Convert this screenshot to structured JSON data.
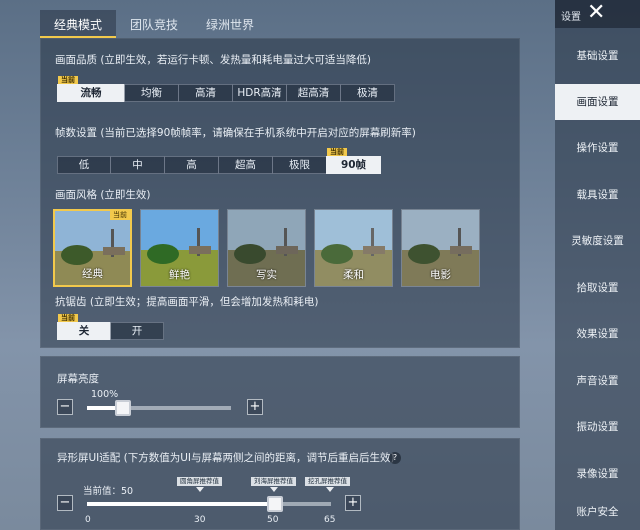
{
  "top_tabs": [
    "经典模式",
    "团队竞技",
    "绿洲世界"
  ],
  "quality": {
    "label": "画面品质 (立即生效，若运行卡顿、发热量和耗电量过大可适当降低)",
    "options": [
      "流畅",
      "均衡",
      "高清",
      "HDR高清",
      "超高清",
      "极清"
    ],
    "current_badge": "当前"
  },
  "fps": {
    "label": "帧数设置 (当前已选择90帧帧率，请确保在手机系统中开启对应的屏幕刷新率)",
    "options": [
      "低",
      "中",
      "高",
      "超高",
      "极限",
      "90帧"
    ],
    "current_badge": "当前"
  },
  "style": {
    "label": "画面风格 (立即生效)",
    "options": [
      "经典",
      "鲜艳",
      "写实",
      "柔和",
      "电影"
    ],
    "current_badge": "当前"
  },
  "aa": {
    "label": "抗锯齿 (立即生效；提高画面平滑，但会增加发热和耗电)",
    "options": [
      "关",
      "开"
    ],
    "current_badge": "当前"
  },
  "brightness": {
    "label": "屏幕亮度",
    "value_text": "100%",
    "value": 0.25,
    "minus": "−",
    "plus": "+"
  },
  "notch": {
    "label": "异形屏UI适配 (下方数值为UI与屏幕两侧之间的距离，调节后重启后生效)",
    "help": "?",
    "current_text": "当前值：50",
    "markers": [
      "圆角屏推荐值",
      "刘海屏推荐值",
      "挖孔屏推荐值"
    ],
    "ticks": [
      "0",
      "30",
      "50",
      "65"
    ],
    "value": 50,
    "minus": "−",
    "plus": "+"
  },
  "sidebar": {
    "title": "设置",
    "close": "✕",
    "items": [
      "基础设置",
      "画面设置",
      "操作设置",
      "载具设置",
      "灵敏度设置",
      "拾取设置",
      "效果设置",
      "声音设置",
      "振动设置",
      "录像设置",
      "账户安全"
    ]
  },
  "colors": {
    "accent": "#f2c94c",
    "selected_bg": "#eef1f4"
  }
}
